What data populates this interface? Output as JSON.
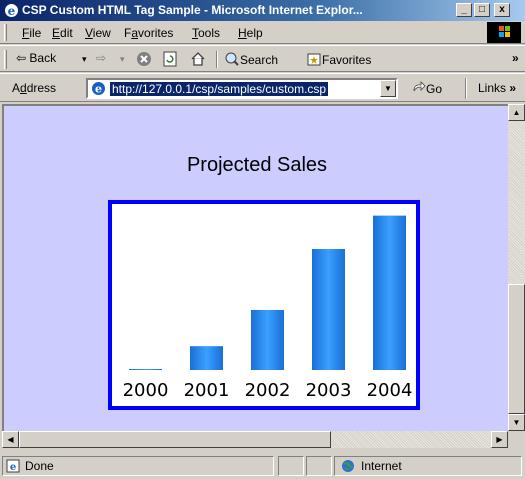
{
  "window": {
    "title": "CSP Custom HTML Tag Sample - Microsoft Internet Explor...",
    "minimize": "_",
    "maximize": "□",
    "close": "x"
  },
  "menu": {
    "items": [
      {
        "accel": "F",
        "rest": "ile"
      },
      {
        "accel": "E",
        "rest": "dit"
      },
      {
        "accel": "V",
        "rest": "iew"
      },
      {
        "pre": "F",
        "accel": "a",
        "rest": "vorites"
      },
      {
        "accel": "T",
        "rest": "ools"
      },
      {
        "accel": "H",
        "rest": "elp"
      }
    ]
  },
  "toolbar": {
    "back": "⇦ Back",
    "back_drop": "▾",
    "forward": "⇨",
    "forward_drop": "▾",
    "stop": "⊗",
    "refresh": "⟳",
    "home": "⌂",
    "search": "Search",
    "favorites": "Favorites",
    "more": "»"
  },
  "address": {
    "label_accel": "d",
    "label_pre": "A",
    "label_rest": "dress",
    "url": "http://127.0.0.1/csp/samples/custom.csp",
    "go": "Go",
    "links": "Links",
    "links_more": "»"
  },
  "page": {
    "heading": "Projected Sales"
  },
  "chart_data": {
    "type": "bar",
    "title": "",
    "categories": [
      "2000",
      "2001",
      "2002",
      "2003",
      "2004"
    ],
    "values": [
      1,
      25,
      63,
      127,
      162
    ],
    "ylim": [
      0,
      170
    ],
    "bar_color": "#1e7fe0",
    "frame_color": "#0000ff"
  },
  "status": {
    "text": "Done",
    "zone": "Internet"
  },
  "colors": {
    "content_bg": "#ccccff",
    "title_bar": "#0a246a",
    "chrome": "#d4d0c8"
  }
}
